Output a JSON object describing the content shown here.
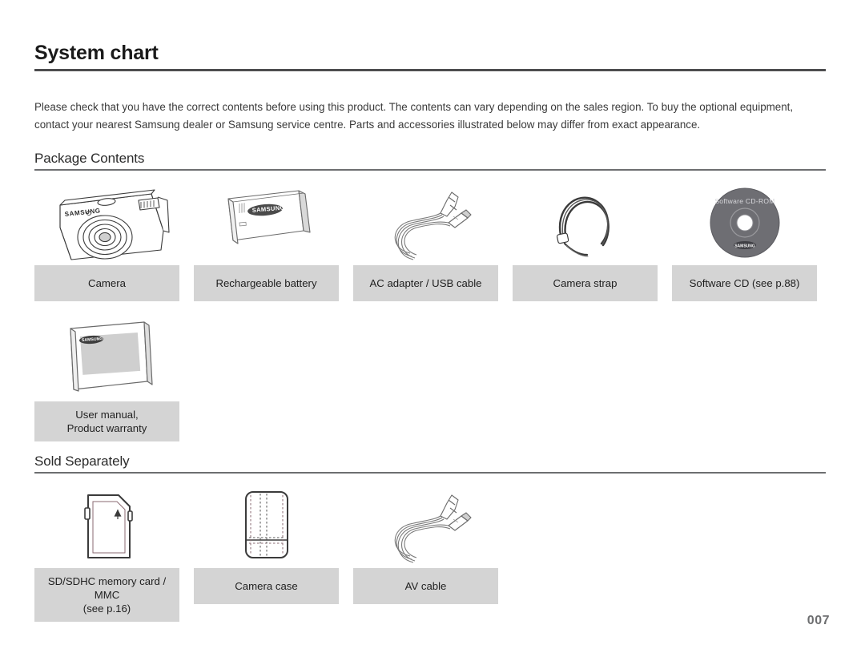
{
  "document": {
    "title": "System chart",
    "intro": "Please check that you have the correct contents before using this product. The contents can vary depending on the sales region. To buy the optional equipment, contact your nearest Samsung dealer or Samsung service centre. Parts and accessories illustrated below may differ from exact appearance.",
    "page_number": "007"
  },
  "sections": [
    {
      "heading": "Package Contents",
      "items": [
        {
          "icon": "camera-icon",
          "caption_line1": "Camera",
          "caption_line2": ""
        },
        {
          "icon": "battery-icon",
          "caption_line1": "Rechargeable battery",
          "caption_line2": ""
        },
        {
          "icon": "usb-cable-icon",
          "caption_line1": "AC adapter / USB cable",
          "caption_line2": ""
        },
        {
          "icon": "strap-icon",
          "caption_line1": "Camera strap",
          "caption_line2": ""
        },
        {
          "icon": "cd-icon",
          "caption_line1": "Software CD (see p.88)",
          "caption_line2": ""
        },
        {
          "icon": "manual-icon",
          "caption_line1": "User manual,",
          "caption_line2": "Product warranty"
        }
      ]
    },
    {
      "heading": "Sold Separately",
      "items": [
        {
          "icon": "sd-card-icon",
          "caption_line1": "SD/SDHC memory card / MMC",
          "caption_line2": "(see p.16)"
        },
        {
          "icon": "case-icon",
          "caption_line1": "Camera case",
          "caption_line2": ""
        },
        {
          "icon": "av-cable-icon",
          "caption_line1": "AV cable",
          "caption_line2": ""
        }
      ]
    }
  ],
  "artwork_labels": {
    "camera_brand": "SAMSUNG",
    "battery_brand": "SAMSUNG",
    "cd_label": "Software CD-ROM"
  },
  "colors": {
    "caption_background": "#d4d4d4",
    "rule": "#6d6e70",
    "title_rule": "#4d4d4f",
    "text": "#231f20",
    "page_number": "#6d6e70",
    "cd_disc": "#6e6e73",
    "strap": "#3a3a3a"
  }
}
